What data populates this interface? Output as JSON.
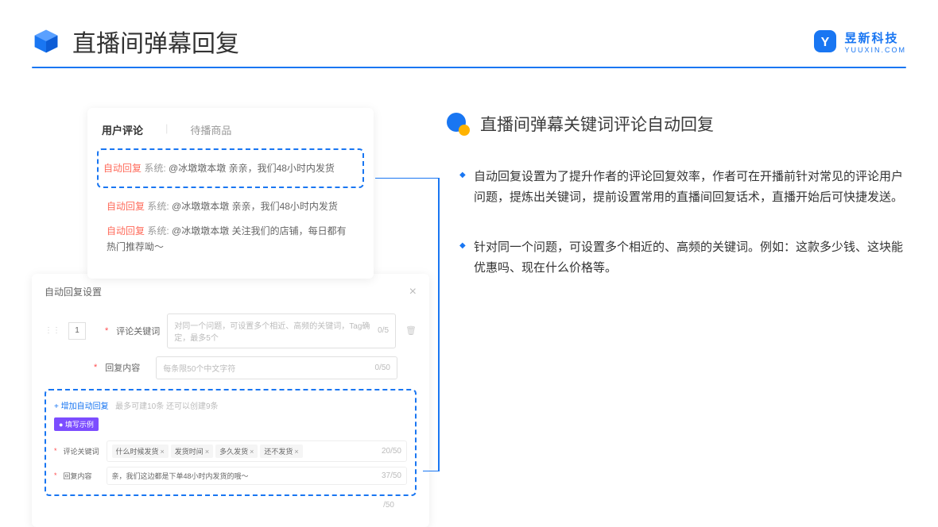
{
  "page_title": "直播间弹幕回复",
  "brand": {
    "name": "昱新科技",
    "url": "YUUXIN.COM"
  },
  "comment_card": {
    "tab_active": "用户评论",
    "tab_inactive": "待播商品",
    "auto_tag": "自动回复",
    "sys_tag": "系统:",
    "line1": "@冰墩墩本墩 亲亲，我们48小时内发货",
    "line2": "@冰墩墩本墩 亲亲，我们48小时内发货",
    "line3": "@冰墩墩本墩 关注我们的店铺，每日都有热门推荐呦～"
  },
  "settings": {
    "title": "自动回复设置",
    "row_num": "1",
    "keyword_label": "评论关键词",
    "keyword_placeholder": "对同一个问题，可设置多个相近、高频的关键词，Tag确定，最多5个",
    "keyword_counter": "0/5",
    "content_label": "回复内容",
    "content_placeholder": "每条限50个中文字符",
    "content_counter": "0/50",
    "add_link": "+ 增加自动回复",
    "add_hint": "最多可建10条 还可以创建9条",
    "example_badge": "● 填写示例",
    "ex_kw_label": "评论关键词",
    "ex_tags": [
      "什么时候发货",
      "发货时间",
      "多久发货",
      "还不发货"
    ],
    "ex_kw_counter": "20/50",
    "ex_content_label": "回复内容",
    "ex_content_value": "亲，我们这边都是下单48小时内发货的哦～",
    "ex_content_counter": "37/50",
    "outer_counter": "/50"
  },
  "right": {
    "section_title": "直播间弹幕关键词评论自动回复",
    "bullets": [
      "自动回复设置为了提升作者的评论回复效率，作者可在开播前针对常见的评论用户问题，提炼出关键词，提前设置常用的直播间回复话术，直播开始后可快捷发送。",
      "针对同一个问题，可设置多个相近的、高频的关键词。例如：这款多少钱、这块能优惠吗、现在什么价格等。"
    ]
  }
}
